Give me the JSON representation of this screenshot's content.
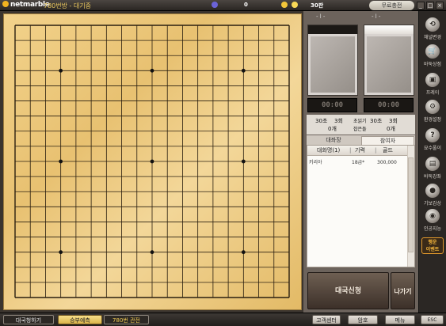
{
  "header": {
    "logo": "netmarble",
    "room_title": "780번방 - 대기중",
    "stat_value": "0",
    "money": "30판",
    "charge_button": "무료충전",
    "win_buttons": [
      "_",
      "□",
      "×"
    ]
  },
  "board": {
    "size": 19,
    "star_points": [
      3,
      9,
      15
    ]
  },
  "match": {
    "top_scores": [
      "- l -",
      "- l -"
    ],
    "timers": [
      "00:00",
      "00:00"
    ],
    "left_time": "30초",
    "left_count": "3회",
    "right_time": "30초",
    "right_count": "3회",
    "left_captures": "0개",
    "right_captures": "0개",
    "center_label_1": "초읽기",
    "center_label_2": "잡은돌"
  },
  "tabs": {
    "spectators": "대좌장",
    "participants": "참여자"
  },
  "participant_list": {
    "headers": [
      "대화명(1)",
      "기력",
      "골드"
    ],
    "rows": [
      {
        "name": "키리아",
        "rank": "18급*",
        "gold": "300,000"
      }
    ]
  },
  "actions": {
    "start": "대국신청",
    "exit": "나가기"
  },
  "sidebar": {
    "items": [
      {
        "label": "채널변경",
        "icon": "channel-icon",
        "glyph": "⟲"
      },
      {
        "label": "바둑상점",
        "icon": "shop-cart-icon",
        "glyph": "🛒"
      },
      {
        "label": "프레이",
        "icon": "monitor-icon",
        "glyph": "▣"
      },
      {
        "label": "환경설정",
        "icon": "gear-icon",
        "glyph": "⚙"
      },
      {
        "label": "묘수풀이",
        "icon": "question-icon",
        "glyph": "?"
      },
      {
        "label": "바둑강좌",
        "icon": "book-icon",
        "glyph": "▤"
      },
      {
        "label": "기보감상",
        "icon": "stones-icon",
        "glyph": "●"
      },
      {
        "label": "인공지능",
        "icon": "ai-icon",
        "glyph": "◉"
      }
    ],
    "lucky_label_1": "행운",
    "lucky_label_2": "이벤트"
  },
  "footer": {
    "invite": "대국청하기",
    "message": "승부예측",
    "watch": "780번 관전",
    "cs": "고객센터",
    "password": "암호",
    "menu": "메뉴",
    "esc": "ESC"
  }
}
